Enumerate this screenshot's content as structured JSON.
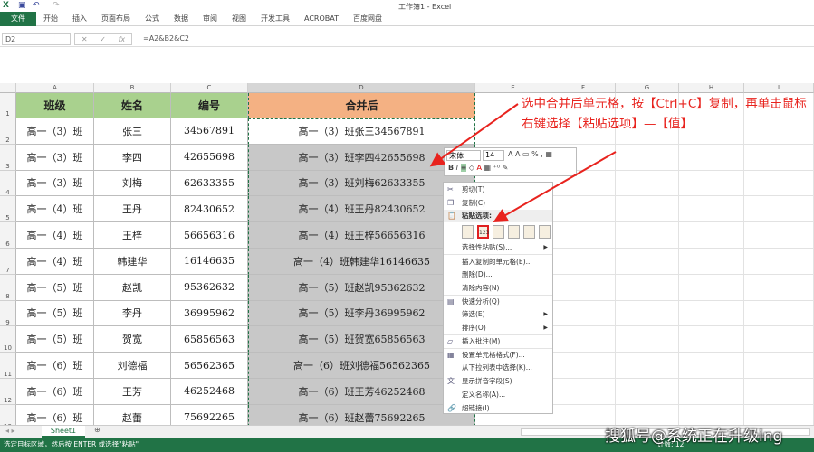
{
  "window": {
    "title": "工作簿1 - Excel"
  },
  "ribbon": {
    "tabs": [
      "文件",
      "开始",
      "插入",
      "页面布局",
      "公式",
      "数据",
      "审阅",
      "视图",
      "开发工具",
      "ACROBAT",
      "百度网盘"
    ]
  },
  "formula_bar": {
    "name_box": "D2",
    "formula": "=A2&B2&C2",
    "cancel": "✕",
    "enter": "✓",
    "fx": "fx"
  },
  "columns": [
    "A",
    "B",
    "C",
    "D",
    "E",
    "F",
    "G",
    "H",
    "I"
  ],
  "table": {
    "headers": [
      "班级",
      "姓名",
      "编号",
      "合并后"
    ],
    "rows": [
      [
        "高一（3）班",
        "张三",
        "34567891",
        "高一（3）班张三34567891"
      ],
      [
        "高一（3）班",
        "李四",
        "42655698",
        "高一（3）班李四42655698"
      ],
      [
        "高一（3）班",
        "刘梅",
        "62633355",
        "高一（3）班刘梅62633355"
      ],
      [
        "高一（4）班",
        "王丹",
        "82430652",
        "高一（4）班王丹82430652"
      ],
      [
        "高一（4）班",
        "王梓",
        "56656316",
        "高一（4）班王梓56656316"
      ],
      [
        "高一（4）班",
        "韩建华",
        "16146635",
        "高一（4）班韩建华16146635"
      ],
      [
        "高一（5）班",
        "赵凯",
        "95362632",
        "高一（5）班赵凯95362632"
      ],
      [
        "高一（5）班",
        "李丹",
        "36995962",
        "高一（5）班李丹36995962"
      ],
      [
        "高一（5）班",
        "贺宽",
        "65856563",
        "高一（5）班贺宽65856563"
      ],
      [
        "高一（6）班",
        "刘德福",
        "56562365",
        "高一（6）班刘德福56562365"
      ],
      [
        "高一（6）班",
        "王芳",
        "46252468",
        "高一（6）班王芳46252468"
      ],
      [
        "高一（6）班",
        "赵蕾",
        "75692265",
        "高一（6）班赵蕾75692265"
      ]
    ]
  },
  "mini_toolbar": {
    "font": "宋体",
    "size": "14"
  },
  "context_menu": {
    "cut": "剪切(T)",
    "copy": "复制(C)",
    "paste_options": "粘贴选项:",
    "paste_special": "选择性粘贴(S)...",
    "insert_copied": "插入复制的单元格(E)...",
    "delete": "删除(D)...",
    "clear": "清除内容(N)",
    "quick_analysis": "快速分析(Q)",
    "filter": "筛选(E)",
    "sort": "排序(O)",
    "insert_comment": "插入批注(M)",
    "format_cells": "设置单元格格式(F)...",
    "pick_list": "从下拉列表中选择(K)...",
    "phonetic": "显示拼音字段(S)",
    "define_name": "定义名称(A)...",
    "hyperlink": "超链接(I)...",
    "paste_value_icon": "123"
  },
  "annotation": "选中合并后单元格，按【Ctrl+C】复制，再单击鼠标右键选择【粘贴选项】—【值】",
  "sheet_tabs": [
    "Sheet1"
  ],
  "status": {
    "message": "选定目标区域，然后按 ENTER 或选择\"粘贴\"",
    "count": "计数: 12"
  },
  "watermark": "搜狐号@系统正在升级ing",
  "colors": {
    "accent": "#217346",
    "header_green": "#a9d18e",
    "header_orange": "#f4b183",
    "annotation": "#e8231e"
  }
}
